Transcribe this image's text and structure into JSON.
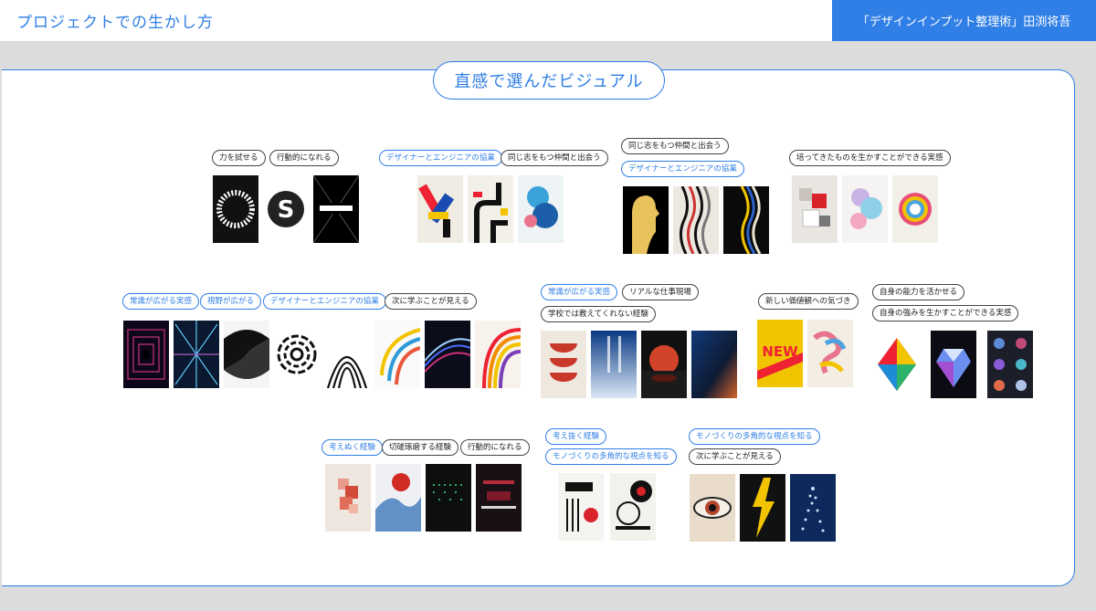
{
  "header": {
    "title": "プロジェクトでの生かし方",
    "source": "「デザインインプット整理術」田渕将吾"
  },
  "panel": {
    "title": "直感で選んだビジュアル"
  },
  "groups": [
    {
      "tags": [
        "力を試せる",
        "行動的になれる"
      ],
      "posters": [
        "white-burst-poster",
        "letter-s-burst-poster",
        "impact-text-poster"
      ]
    },
    {
      "tags": [
        "デザイナーとエンジニアの協業",
        "同じ志をもつ仲間と出会う"
      ],
      "posters": [
        "geometric-shapes-poster",
        "black-pipe-lines-poster",
        "blue-fluid-shapes-poster"
      ]
    },
    {
      "tags": [
        "同じ志をもつ仲間と出会う",
        "デザイナーとエンジニアの協業"
      ],
      "posters": [
        "yellow-profile-faces-poster",
        "striped-profile-faces-poster",
        "wavy-profile-faces-poster"
      ]
    },
    {
      "tags": [
        "培ってきたものを生かすことができる実感"
      ],
      "posters": [
        "red-cubes-poster",
        "gradient-blobs-poster",
        "colorful-ring-poster"
      ]
    },
    {
      "tags": [
        "常識が広がる実感",
        "視野が広がる",
        "デザイナーとエンジニアの協業",
        "次に学ぶことが見える"
      ],
      "posters": [
        "purple-tunnel-poster",
        "blue-burst-poster",
        "black-swirl-poster",
        "maze-circle-poster",
        "stripe-arch-poster",
        "color-ribbon-poster",
        "light-trail-poster",
        "rainbow-curves-poster"
      ]
    },
    {
      "tags": [
        "常識が広がる実感",
        "リアルな仕事現場",
        "学校では教えてくれない経験"
      ],
      "posters": [
        "red-semicircles-poster",
        "blue-gradient-poster",
        "red-sphere-poster",
        "blue-orange-gradient-poster"
      ]
    },
    {
      "tags": [
        "新しい価値観への気づき"
      ],
      "posters": [
        "new-typography-poster",
        "colorful-3d-text-poster"
      ]
    },
    {
      "tags": [
        "自身の能力を活かせる",
        "自身の強みを生かすことができる実感"
      ],
      "posters": [
        "colorful-diamond-poster",
        "crystal-gem-poster",
        "gemstones-grid-poster"
      ]
    },
    {
      "tags": [
        "考えぬく経験",
        "切磋琢磨する経験",
        "行動的になれる"
      ],
      "posters": [
        "pixel-blur-poster",
        "blue-smoke-poster",
        "green-grid-poster",
        "dark-red-glitch-poster"
      ]
    },
    {
      "tags": [
        "考え抜く経験",
        "モノづくりの多角的な視点を知る"
      ],
      "posters": [
        "bw-geometric-poster",
        "circle-geometric-poster"
      ]
    },
    {
      "tags": [
        "モノづくりの多角的な視点を知る",
        "次に学ぶことが見える"
      ],
      "posters": [
        "eye-poster",
        "lightning-poster",
        "particle-figure-poster"
      ]
    }
  ]
}
